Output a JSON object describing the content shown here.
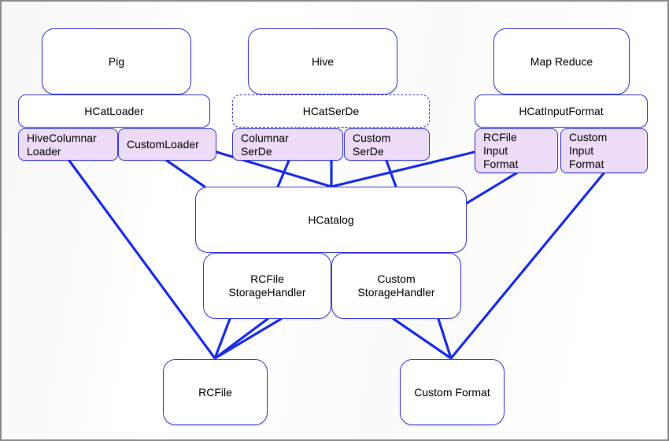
{
  "diagram": {
    "colors": {
      "box_border": "#3b3fd8",
      "sub_fill": "#ecdcf8",
      "wire": "#1a2ee6"
    },
    "frameworks": [
      {
        "id": "pig",
        "label": "Pig"
      },
      {
        "id": "hive",
        "label": "Hive"
      },
      {
        "id": "mapreduce",
        "label": "Map Reduce"
      }
    ],
    "interfaces": [
      {
        "id": "hcatloader",
        "label": "HCatLoader",
        "style": "solid"
      },
      {
        "id": "hcatserde",
        "label": "HCatSerDe",
        "style": "dashed"
      },
      {
        "id": "hcatinputformat",
        "label": "HCatInputFormat",
        "style": "solid"
      }
    ],
    "components": [
      {
        "id": "hivecolumnarloader",
        "label": "HiveColumnar\nLoader"
      },
      {
        "id": "customloader",
        "label": "CustomLoader"
      },
      {
        "id": "columnarserde",
        "label": "Columnar\nSerDe"
      },
      {
        "id": "customserde",
        "label": "Custom\nSerDe"
      },
      {
        "id": "rcfileinputformat",
        "label": "RCFile\nInput\nFormat"
      },
      {
        "id": "custominputformat",
        "label": "Custom\nInput\nFormat"
      }
    ],
    "core": {
      "id": "hcatalog",
      "label": "HCatalog"
    },
    "storage_handlers": [
      {
        "id": "rcfilestoragehandler",
        "label": "RCFile\nStorageHandler"
      },
      {
        "id": "customstoragehandler",
        "label": "Custom\nStorageHandler"
      }
    ],
    "formats": [
      {
        "id": "rcfile",
        "label": "RCFile"
      },
      {
        "id": "customformat",
        "label": "Custom Format"
      }
    ],
    "edges": [
      {
        "from": "hivecolumnarloader",
        "to": "rcfile"
      },
      {
        "from": "customloader",
        "to": "hcatalog"
      },
      {
        "from": "customloader",
        "to": "hcatalog"
      },
      {
        "from": "columnarserde",
        "to": "hcatalog"
      },
      {
        "from": "columnarserde",
        "to": "hcatalog"
      },
      {
        "from": "customserde",
        "to": "hcatalog"
      },
      {
        "from": "rcfileinputformat",
        "to": "hcatalog"
      },
      {
        "from": "rcfileinputformat",
        "to": "hcatalog"
      },
      {
        "from": "custominputformat",
        "to": "customformat"
      },
      {
        "from": "rcfilestoragehandler",
        "to": "rcfile"
      },
      {
        "from": "rcfilestoragehandler",
        "to": "rcfile"
      },
      {
        "from": "rcfilestoragehandler",
        "to": "rcfile"
      },
      {
        "from": "customstoragehandler",
        "to": "customformat"
      },
      {
        "from": "customstoragehandler",
        "to": "customformat"
      }
    ]
  }
}
